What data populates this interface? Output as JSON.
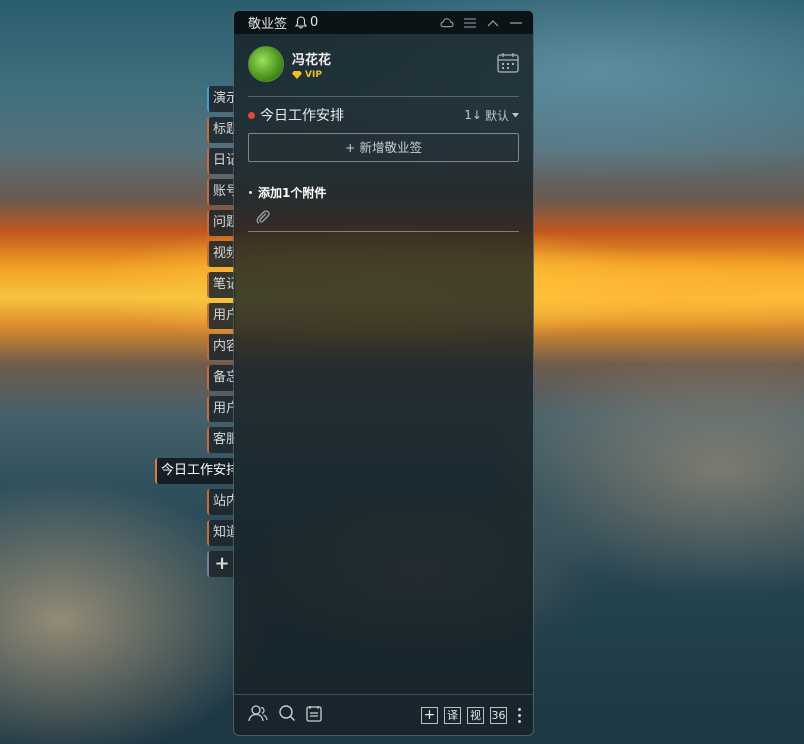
{
  "side_tabs": [
    {
      "label": "演示"
    },
    {
      "label": "标题"
    },
    {
      "label": "日记"
    },
    {
      "label": "账号"
    },
    {
      "label": "问题"
    },
    {
      "label": "视频"
    },
    {
      "label": "笔记"
    },
    {
      "label": "用户"
    },
    {
      "label": "内容"
    },
    {
      "label": "备忘"
    },
    {
      "label": "用户"
    },
    {
      "label": "客服"
    },
    {
      "label": "今日工作安排"
    },
    {
      "label": "站内"
    },
    {
      "label": "知道"
    }
  ],
  "side_add_label": "+",
  "titlebar": {
    "app_name": "敬业签",
    "notification_count": "0"
  },
  "user": {
    "name": "冯花花",
    "badge": "VIP"
  },
  "section": {
    "title": "今日工作安排",
    "sort_label": "默认",
    "sort_prefix": "1↓"
  },
  "add_button_label": "+ 新增敬业签",
  "notes": [
    {
      "title": "添加1个附件"
    }
  ],
  "bottom": {
    "btn_add": "+",
    "btn_translate": "译",
    "btn_view": "视",
    "btn_count": "36"
  },
  "colors": {
    "accent_dot": "#e8453c",
    "vip_gold": "#f0c020",
    "active_tab_border": "#d47a44"
  }
}
